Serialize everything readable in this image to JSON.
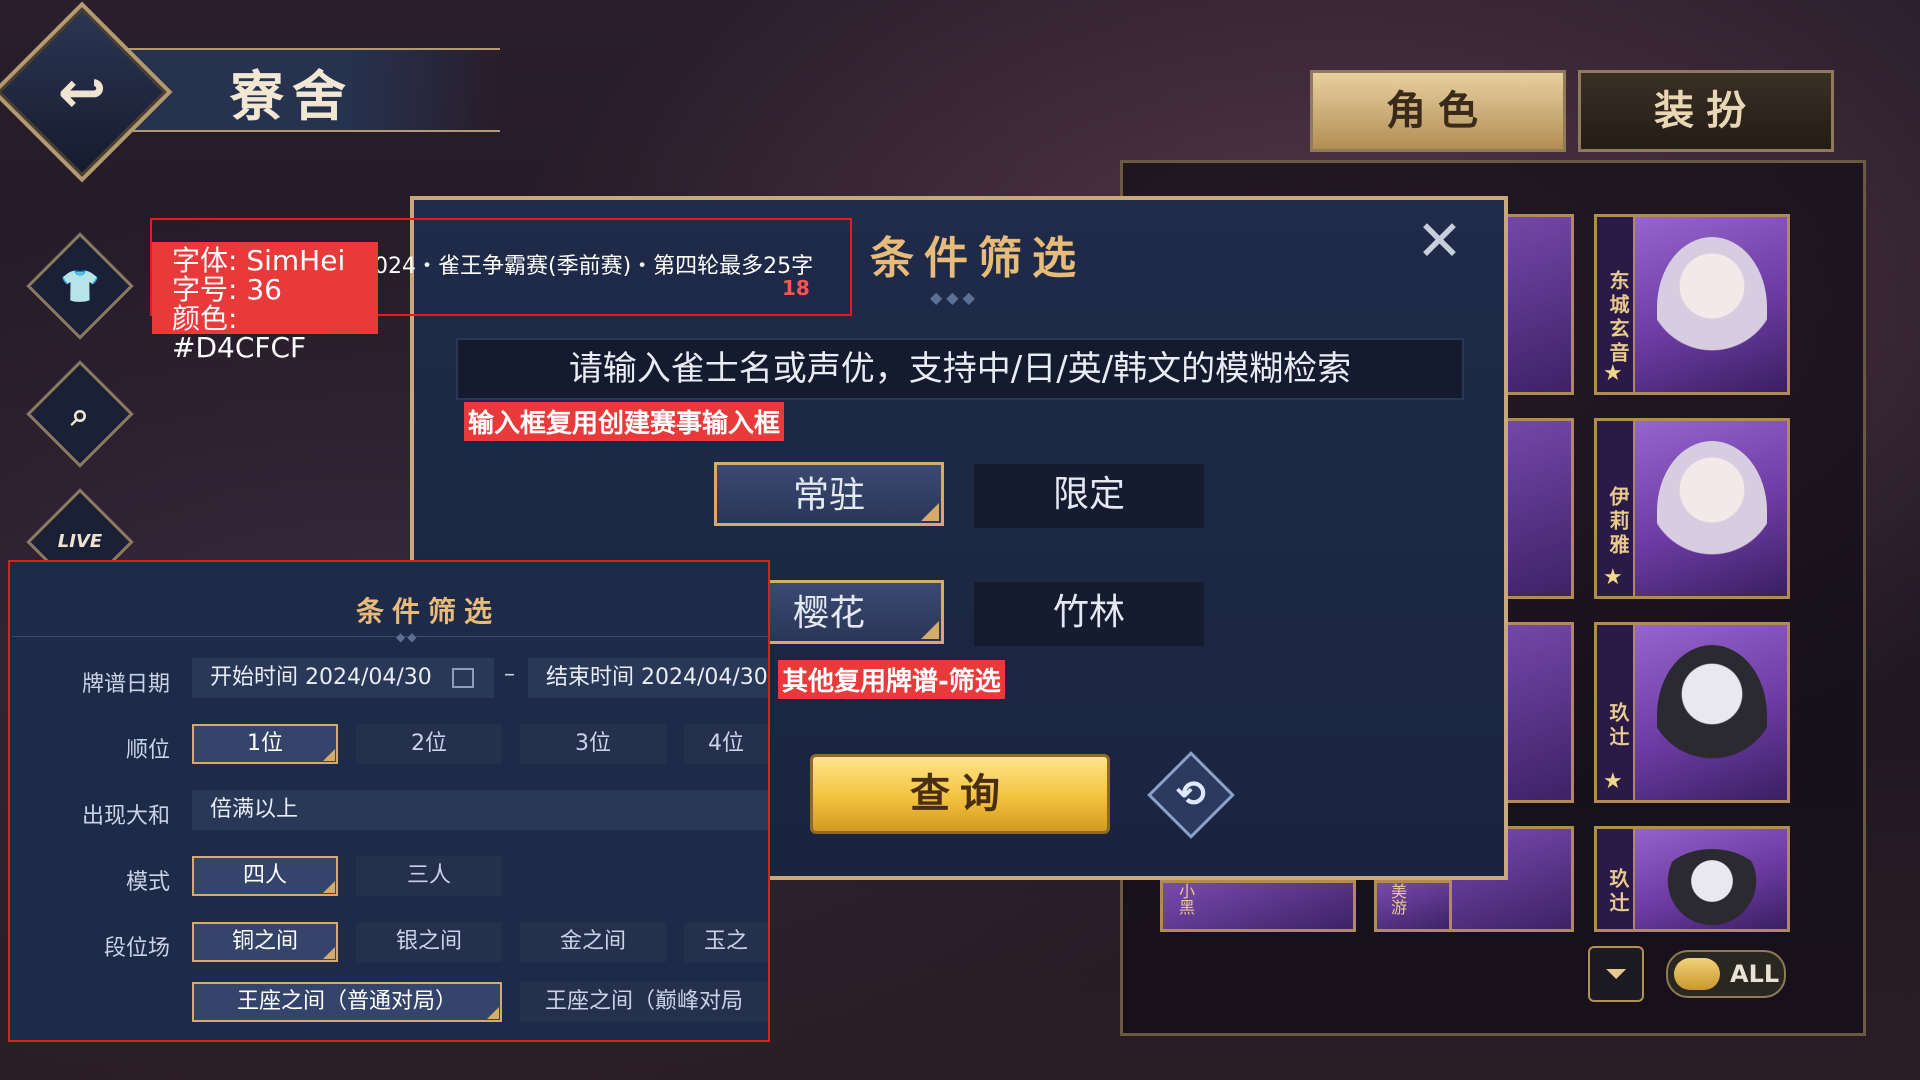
{
  "header": {
    "title": "寮舍",
    "back_icon": "back-arrow-icon"
  },
  "side_icons": [
    "shirt-icon",
    "magnify-icon",
    "live-icon"
  ],
  "side_live_label": "LIVE",
  "tabs": {
    "role": "角色",
    "dress": "装扮"
  },
  "characters": [
    {
      "name": "东城玄音"
    },
    {
      "name": "伊莉雅"
    },
    {
      "name": "玖辻"
    },
    {
      "name": "玖辻"
    }
  ],
  "bottom_card_names": {
    "left": "小黑",
    "mid": "美游"
  },
  "toggles": {
    "all_label": "ALL"
  },
  "dialog": {
    "title": "条件筛选",
    "search_placeholder": "请输入雀士名或声优，支持中/日/英/韩文的模糊检索",
    "row1": [
      {
        "label": "常驻",
        "selected": true
      },
      {
        "label": "限定",
        "selected": false
      }
    ],
    "row2": [
      {
        "label": "樱花",
        "selected": true
      },
      {
        "label": "竹林",
        "selected": false
      }
    ],
    "query_label": "查询"
  },
  "annotations": {
    "font_info_1": "字体: SimHei",
    "font_info_2": "字号: 36",
    "font_info_3": "颜色: #D4CFCF",
    "ticker": "2024・雀王争霸赛(季前赛)・第四轮最多25字",
    "ticker_num": "18",
    "search_note": "输入框复用创建赛事输入框",
    "filter_note": "其他复用牌谱-筛选"
  },
  "inset": {
    "title": "条件筛选",
    "date_label": "牌谱日期",
    "start_date": "开始时间 2024/04/30",
    "dash": "–",
    "end_date": "结束时间 2024/04/30",
    "rank_label": "顺位",
    "ranks": [
      "1位",
      "2位",
      "3位",
      "4位"
    ],
    "yaku_label": "出现大和",
    "yaku_value": "倍满以上",
    "mode_label": "模式",
    "modes": [
      "四人",
      "三人"
    ],
    "room_label": "段位场",
    "rooms": [
      "铜之间",
      "银之间",
      "金之间",
      "玉之"
    ],
    "throne": [
      "王座之间（普通对局）",
      "王座之间（巅峰对局"
    ]
  },
  "colors": {
    "accent_gold": "#D7A96A",
    "annotation_red": "#E83A3A",
    "dialog_bg": "#1F2B48"
  }
}
